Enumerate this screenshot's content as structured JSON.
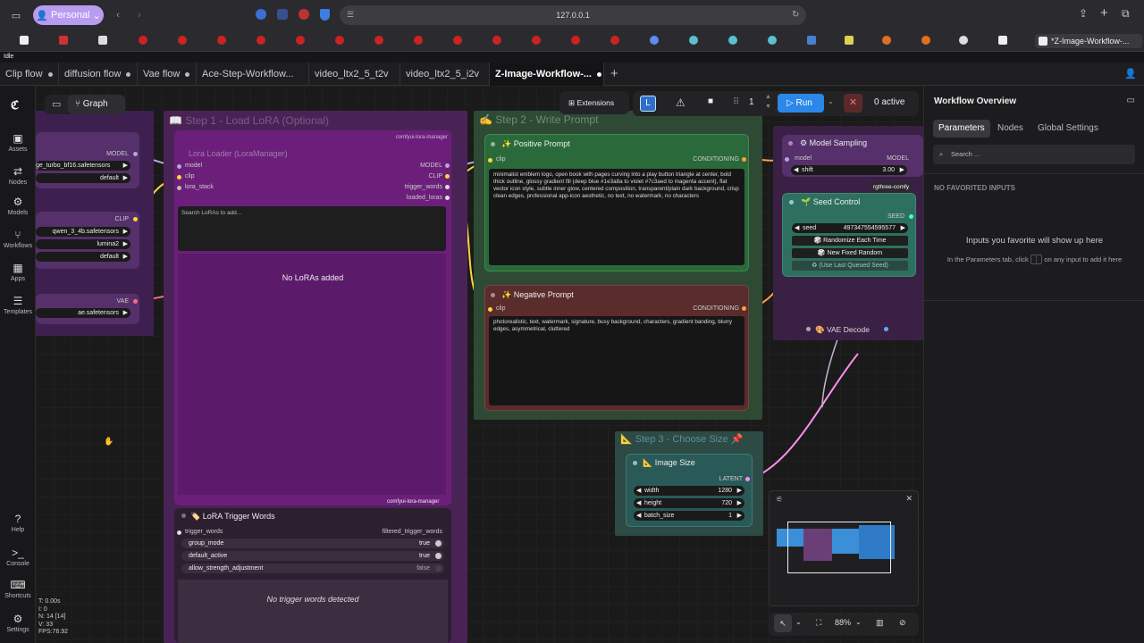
{
  "browser": {
    "profile": "Personal",
    "url": "127.0.0.1",
    "bookmark_active_title": "*Z-Image-Workflow-...",
    "status_text": "Idle"
  },
  "tabs": [
    {
      "label": "Clip flow"
    },
    {
      "label": "diffusion flow"
    },
    {
      "label": "Vae flow"
    },
    {
      "label": "Ace-Step-Workflow..."
    },
    {
      "label": "video_ltx2_5_t2v"
    },
    {
      "label": "video_ltx2_5_i2v"
    },
    {
      "label": "Z-Image-Workflow-..."
    }
  ],
  "sidebar": {
    "items": [
      {
        "label": "Assets"
      },
      {
        "label": "Nodes"
      },
      {
        "label": "Models"
      },
      {
        "label": "Workflows"
      },
      {
        "label": "Apps"
      },
      {
        "label": "Templates"
      }
    ],
    "bottom": [
      {
        "label": "Help"
      },
      {
        "label": "Console"
      },
      {
        "label": "Shortcuts"
      },
      {
        "label": "Settings"
      }
    ]
  },
  "toolbar": {
    "graph_label": "Graph",
    "extensions_label": "Extensions",
    "count": "1",
    "run_label": "Run",
    "active_label": "0 active"
  },
  "groups": {
    "step1": "Step 1 - Load LoRA (Optional)",
    "step2": "Step 2 - Write Prompt",
    "step3": "Step 3 - Choose Size"
  },
  "loaders": {
    "model_label": "MODEL",
    "model_file": "ge_turbo_bf16.safetensors",
    "model_dtype": "default",
    "clip_label": "CLIP",
    "clip_file": "qwen_3_4b.safetensors",
    "clip_type": "lumina2",
    "clip_device": "default",
    "vae_label": "VAE",
    "vae_file": "ae.safetensors"
  },
  "lora_loader": {
    "title": "Lora Loader (LoraManager)",
    "source": "comfyui-lora-manager",
    "in_model": "model",
    "in_clip": "clip",
    "in_stack": "lora_stack",
    "out_model": "MODEL",
    "out_clip": "CLIP",
    "out_trigger": "trigger_words",
    "out_loaded": "loaded_loras",
    "search_placeholder": "Search LoRAs to add...",
    "empty": "No LoRAs added",
    "footer_source": "comfyui-lora-manager"
  },
  "trigger_node": {
    "title": "LoRA Trigger Words",
    "in": "trigger_words",
    "out": "filtered_trigger_words",
    "rows": [
      {
        "label": "group_mode",
        "value": "true"
      },
      {
        "label": "default_active",
        "value": "true"
      },
      {
        "label": "allow_strength_adjustment",
        "value": "false"
      }
    ],
    "empty": "No trigger words detected"
  },
  "positive": {
    "title": "Positive Prompt",
    "in": "clip",
    "out": "CONDITIONING",
    "text": "minimalist emblem logo, open book with pages curving into a play button triangle at center, bold thick outline, glossy gradient fill (deep blue #1e3a8a to violet #7c3aed to magenta accent), flat vector icon style, subtle inner glow, centered composition, transparent/plain dark background, crisp clean edges, professional app-icon aesthetic, no text, no watermark, no characters"
  },
  "negative": {
    "title": "Negative Prompt",
    "in": "clip",
    "out": "CONDITIONING",
    "text": "photorealistic, text, watermark, signature, busy background, characters, gradient banding, blurry edges, asymmetrical, cluttered"
  },
  "sampling": {
    "title": "Model Sampling",
    "in": "model",
    "out": "MODEL",
    "shift_label": "shift",
    "shift_value": "3.00",
    "badge": "rgthree-comfy"
  },
  "seed": {
    "title": "Seed Control",
    "out": "SEED",
    "seed_label": "seed",
    "seed_value": "497347554595577",
    "btn1": "Randomize Each Time",
    "btn2": "New Fixed Random",
    "btn3": "(Use Last Queued Seed)"
  },
  "vae_decode": {
    "title": "VAE Decode"
  },
  "image_size": {
    "title": "Image Size",
    "out": "LATENT",
    "rows": [
      {
        "label": "width",
        "value": "1280"
      },
      {
        "label": "height",
        "value": "720"
      },
      {
        "label": "batch_size",
        "value": "1"
      }
    ]
  },
  "stats": [
    "T: 0.00s",
    "I: 0",
    "N: 14 [14]",
    "V: 33",
    "FPS:76.92"
  ],
  "zoom": "88%",
  "panel": {
    "title": "Workflow Overview",
    "tabs": [
      {
        "label": "Parameters"
      },
      {
        "label": "Nodes"
      },
      {
        "label": "Global Settings"
      }
    ],
    "search_placeholder": "Search ...",
    "section": "NO FAVORITED INPUTS",
    "empty_title": "Inputs you favorite will show up here",
    "empty_hint_a": "In the Parameters tab, click",
    "empty_hint_b": "on any input to add it here"
  },
  "colors": {
    "run": "#2b87e8",
    "lora_group": "#5a2a63",
    "prompt_group": "#2c4a34",
    "size_group": "#2d4a44"
  }
}
